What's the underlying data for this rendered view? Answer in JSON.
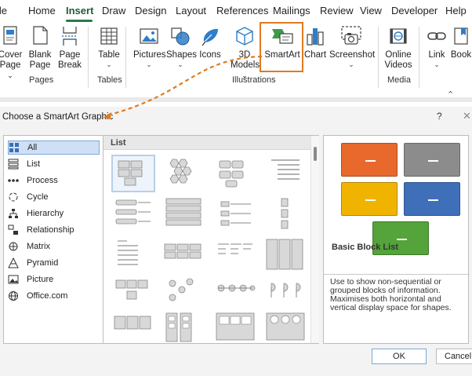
{
  "ribbon": {
    "tabs": [
      "File",
      "Home",
      "Insert",
      "Draw",
      "Design",
      "Layout",
      "References",
      "Mailings",
      "Review",
      "View",
      "Developer",
      "Help"
    ],
    "active_tab": "Insert",
    "groups": {
      "pages": {
        "label": "Pages",
        "cover_page": [
          "Cover",
          "Page"
        ],
        "blank_page": [
          "Blank",
          "Page"
        ],
        "page_break": [
          "Page",
          "Break"
        ]
      },
      "tables": {
        "label": "Tables",
        "table": "Table"
      },
      "illustrations": {
        "label": "Illustrations",
        "pictures": "Pictures",
        "shapes": "Shapes",
        "icons": "Icons",
        "models": [
          "3D",
          "Models"
        ],
        "smartart": "SmartArt",
        "chart": "Chart",
        "screenshot": "Screenshot"
      },
      "media": {
        "label": "Media",
        "online_videos": [
          "Online",
          "Videos"
        ]
      },
      "links": {
        "link": "Link",
        "bookmark": "Book"
      }
    }
  },
  "dialog": {
    "title": "Choose a SmartArt Graphic",
    "help": "?",
    "categories": [
      {
        "label": "All",
        "icon": "all-icon"
      },
      {
        "label": "List",
        "icon": "list-icon"
      },
      {
        "label": "Process",
        "icon": "process-icon"
      },
      {
        "label": "Cycle",
        "icon": "cycle-icon"
      },
      {
        "label": "Hierarchy",
        "icon": "hierarchy-icon"
      },
      {
        "label": "Relationship",
        "icon": "relationship-icon"
      },
      {
        "label": "Matrix",
        "icon": "matrix-icon"
      },
      {
        "label": "Pyramid",
        "icon": "pyramid-icon"
      },
      {
        "label": "Picture",
        "icon": "picture-icon"
      },
      {
        "label": "Office.com",
        "icon": "globe-icon"
      }
    ],
    "selected_category": "All",
    "gallery_header": "List",
    "preview": {
      "title": "Basic Block List",
      "description": "Use to show non-sequential or grouped blocks of information. Maximises both horizontal and vertical display space for shapes.",
      "colors": [
        "#e8692b",
        "#8c8c8c",
        "#f0b400",
        "#3f6fb8",
        "#54a33b"
      ]
    },
    "ok_label": "OK",
    "cancel_label": "Cancel"
  },
  "colors": {
    "highlight": "#e07a1f",
    "accent": "#2a7a4a"
  }
}
